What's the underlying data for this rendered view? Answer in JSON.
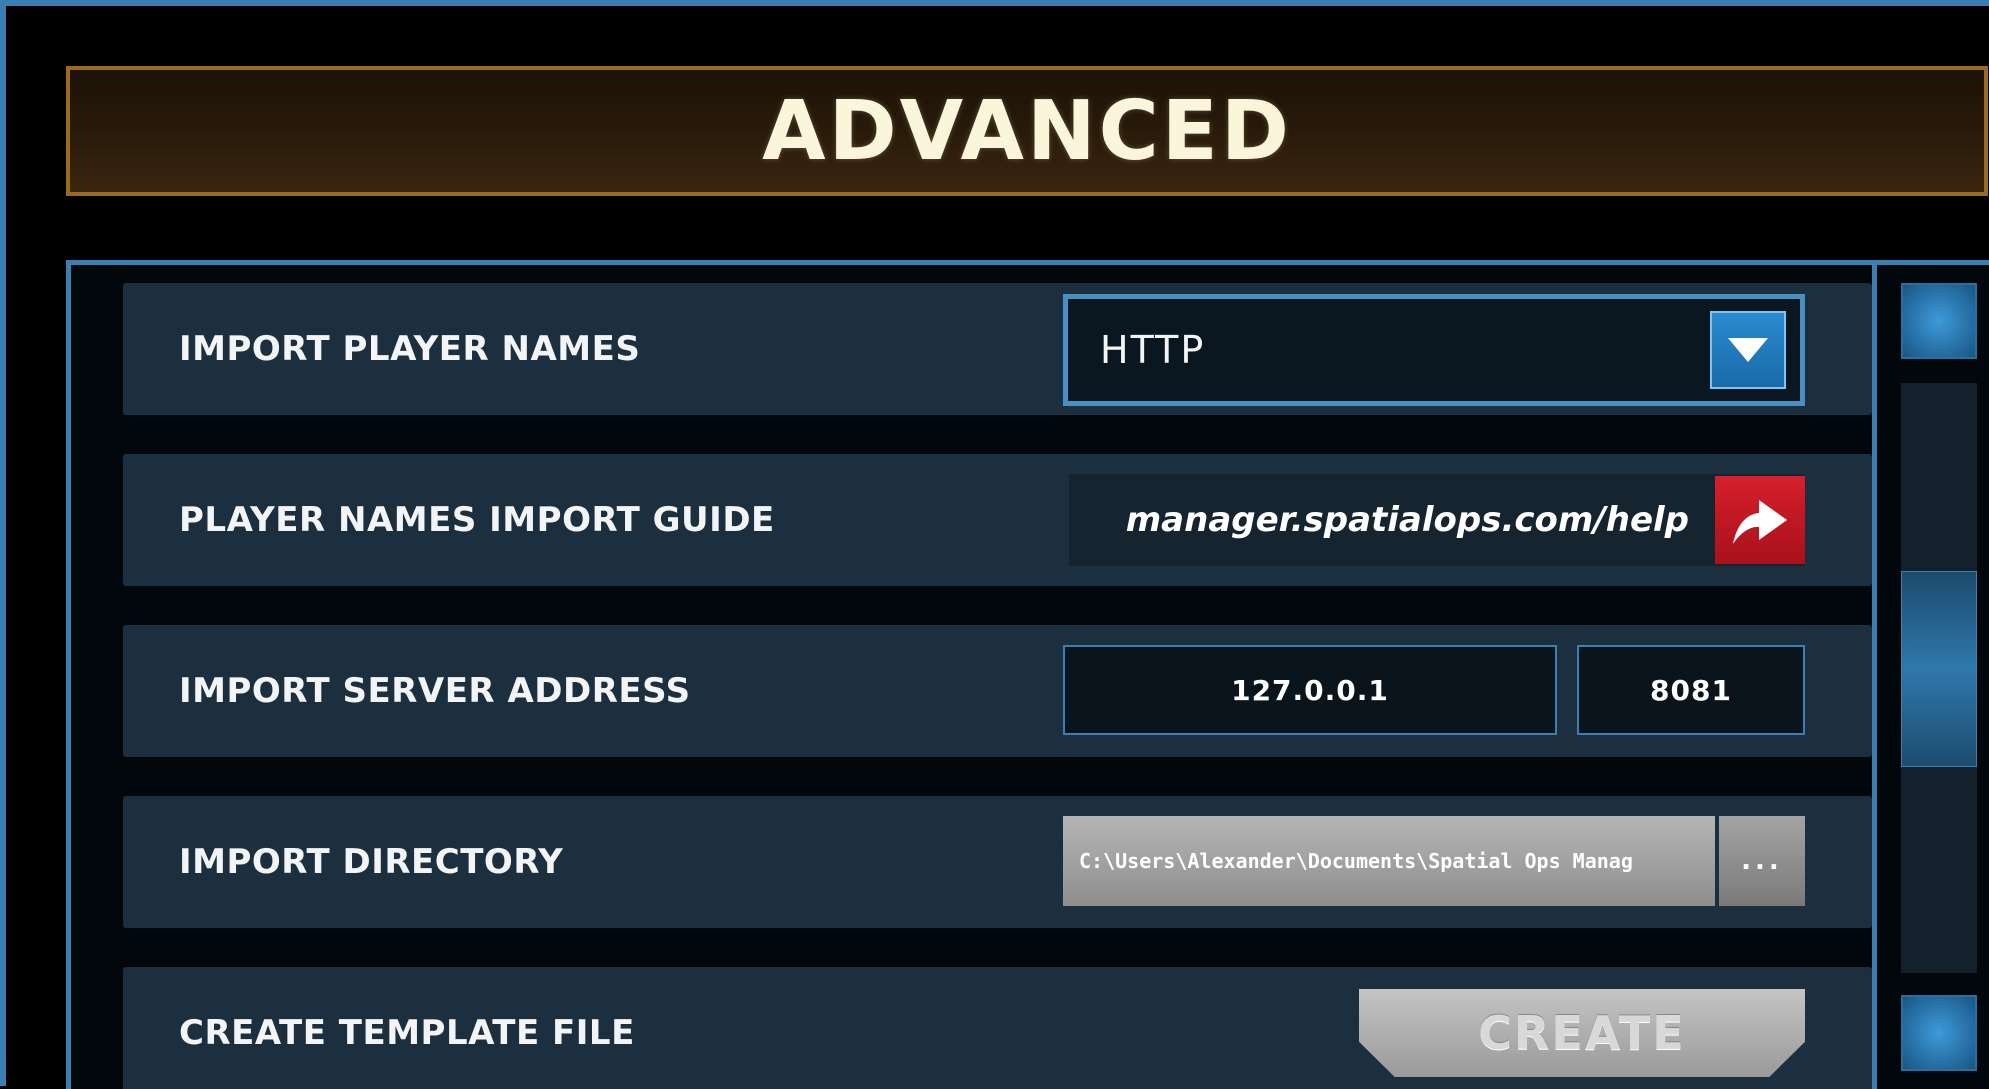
{
  "header": {
    "title": "ADVANCED"
  },
  "settings": {
    "import_player_names": {
      "label": "IMPORT PLAYER NAMES",
      "value": "HTTP"
    },
    "import_guide": {
      "label": "PLAYER NAMES IMPORT GUIDE",
      "link": "manager.spatialops.com/help"
    },
    "server_address": {
      "label": "IMPORT SERVER ADDRESS",
      "ip": "127.0.0.1",
      "port": "8081"
    },
    "import_directory": {
      "label": "IMPORT DIRECTORY",
      "path": "C:\\Users\\Alexander\\Documents\\Spatial Ops Manag",
      "browse_label": "..."
    },
    "template_file": {
      "label": "CREATE TEMPLATE FILE",
      "button_label": "CREATE"
    }
  },
  "colors": {
    "accent_blue": "#3a7fb0",
    "title_border": "#9a6a1e",
    "row_bg": "#1c2f3f",
    "link_button": "#d61f2c"
  },
  "icons": {
    "dropdown": "chevron-down-icon",
    "link": "share-arrow-icon",
    "scroll_up": "scroll-up-button",
    "scroll_down": "scroll-down-button"
  }
}
